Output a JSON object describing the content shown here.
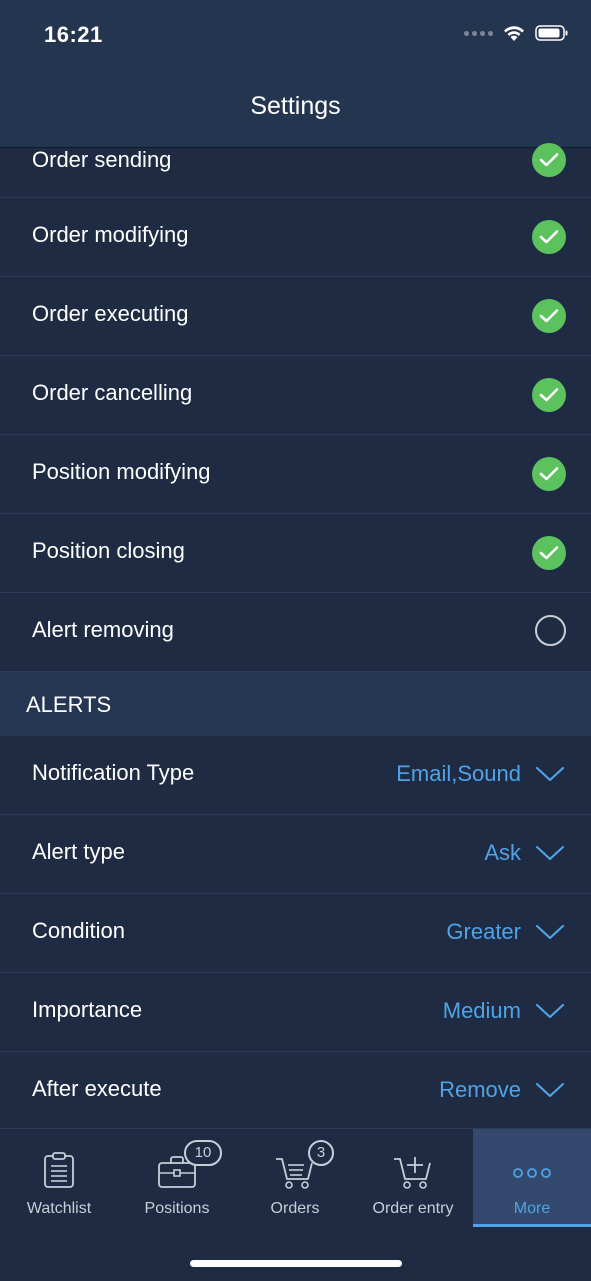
{
  "status_bar": {
    "time": "16:21"
  },
  "header": {
    "title": "Settings"
  },
  "confirmations": [
    {
      "label": "Order sending",
      "checked": true
    },
    {
      "label": "Order modifying",
      "checked": true
    },
    {
      "label": "Order executing",
      "checked": true
    },
    {
      "label": "Order cancelling",
      "checked": true
    },
    {
      "label": "Position modifying",
      "checked": true
    },
    {
      "label": "Position closing",
      "checked": true
    },
    {
      "label": "Alert removing",
      "checked": false
    }
  ],
  "alerts": {
    "section_title": "ALERTS",
    "rows": [
      {
        "label": "Notification Type",
        "value": "Email,Sound"
      },
      {
        "label": "Alert type",
        "value": "Ask"
      },
      {
        "label": "Condition",
        "value": "Greater"
      },
      {
        "label": "Importance",
        "value": "Medium"
      },
      {
        "label": "After execute",
        "value": "Remove"
      }
    ]
  },
  "tab_bar": {
    "watchlist": {
      "label": "Watchlist"
    },
    "positions": {
      "label": "Positions",
      "badge": "10"
    },
    "orders": {
      "label": "Orders",
      "badge": "3"
    },
    "order_entry": {
      "label": "Order entry"
    },
    "more": {
      "label": "More",
      "active": true
    }
  },
  "colors": {
    "background": "#1e2b42",
    "header": "#243550",
    "accent": "#4fa3e6",
    "check": "#5cc25e"
  }
}
